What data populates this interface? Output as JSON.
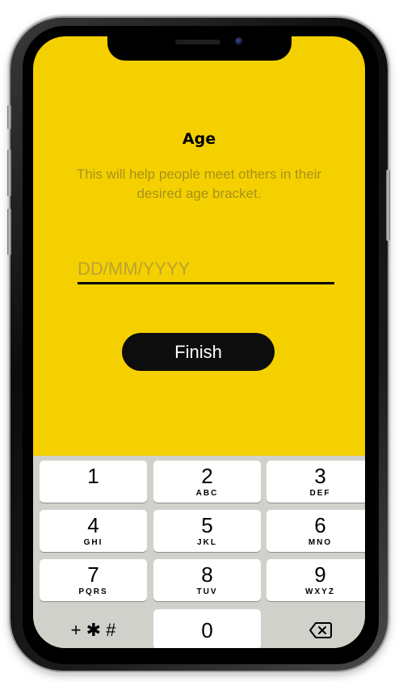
{
  "screen": {
    "title": "Age",
    "subtitle": "This will help people meet others in their desired age bracket.",
    "date_field": {
      "placeholder": "DD/MM/YYYY",
      "value": ""
    },
    "finish_label": "Finish"
  },
  "keypad": {
    "keys": [
      {
        "num": "1",
        "letters": ""
      },
      {
        "num": "2",
        "letters": "ABC"
      },
      {
        "num": "3",
        "letters": "DEF"
      },
      {
        "num": "4",
        "letters": "GHI"
      },
      {
        "num": "5",
        "letters": "JKL"
      },
      {
        "num": "6",
        "letters": "MNO"
      },
      {
        "num": "7",
        "letters": "PQRS"
      },
      {
        "num": "8",
        "letters": "TUV"
      },
      {
        "num": "9",
        "letters": "WXYZ"
      }
    ],
    "symbols_label": "+ ✱ #",
    "zero_label": "0",
    "backspace_icon": "backspace-icon"
  },
  "colors": {
    "screen_background": "#f5d000",
    "subtitle_text": "#a6921a",
    "button_background": "#0d0d0d",
    "keypad_background": "#d1d1cc"
  }
}
